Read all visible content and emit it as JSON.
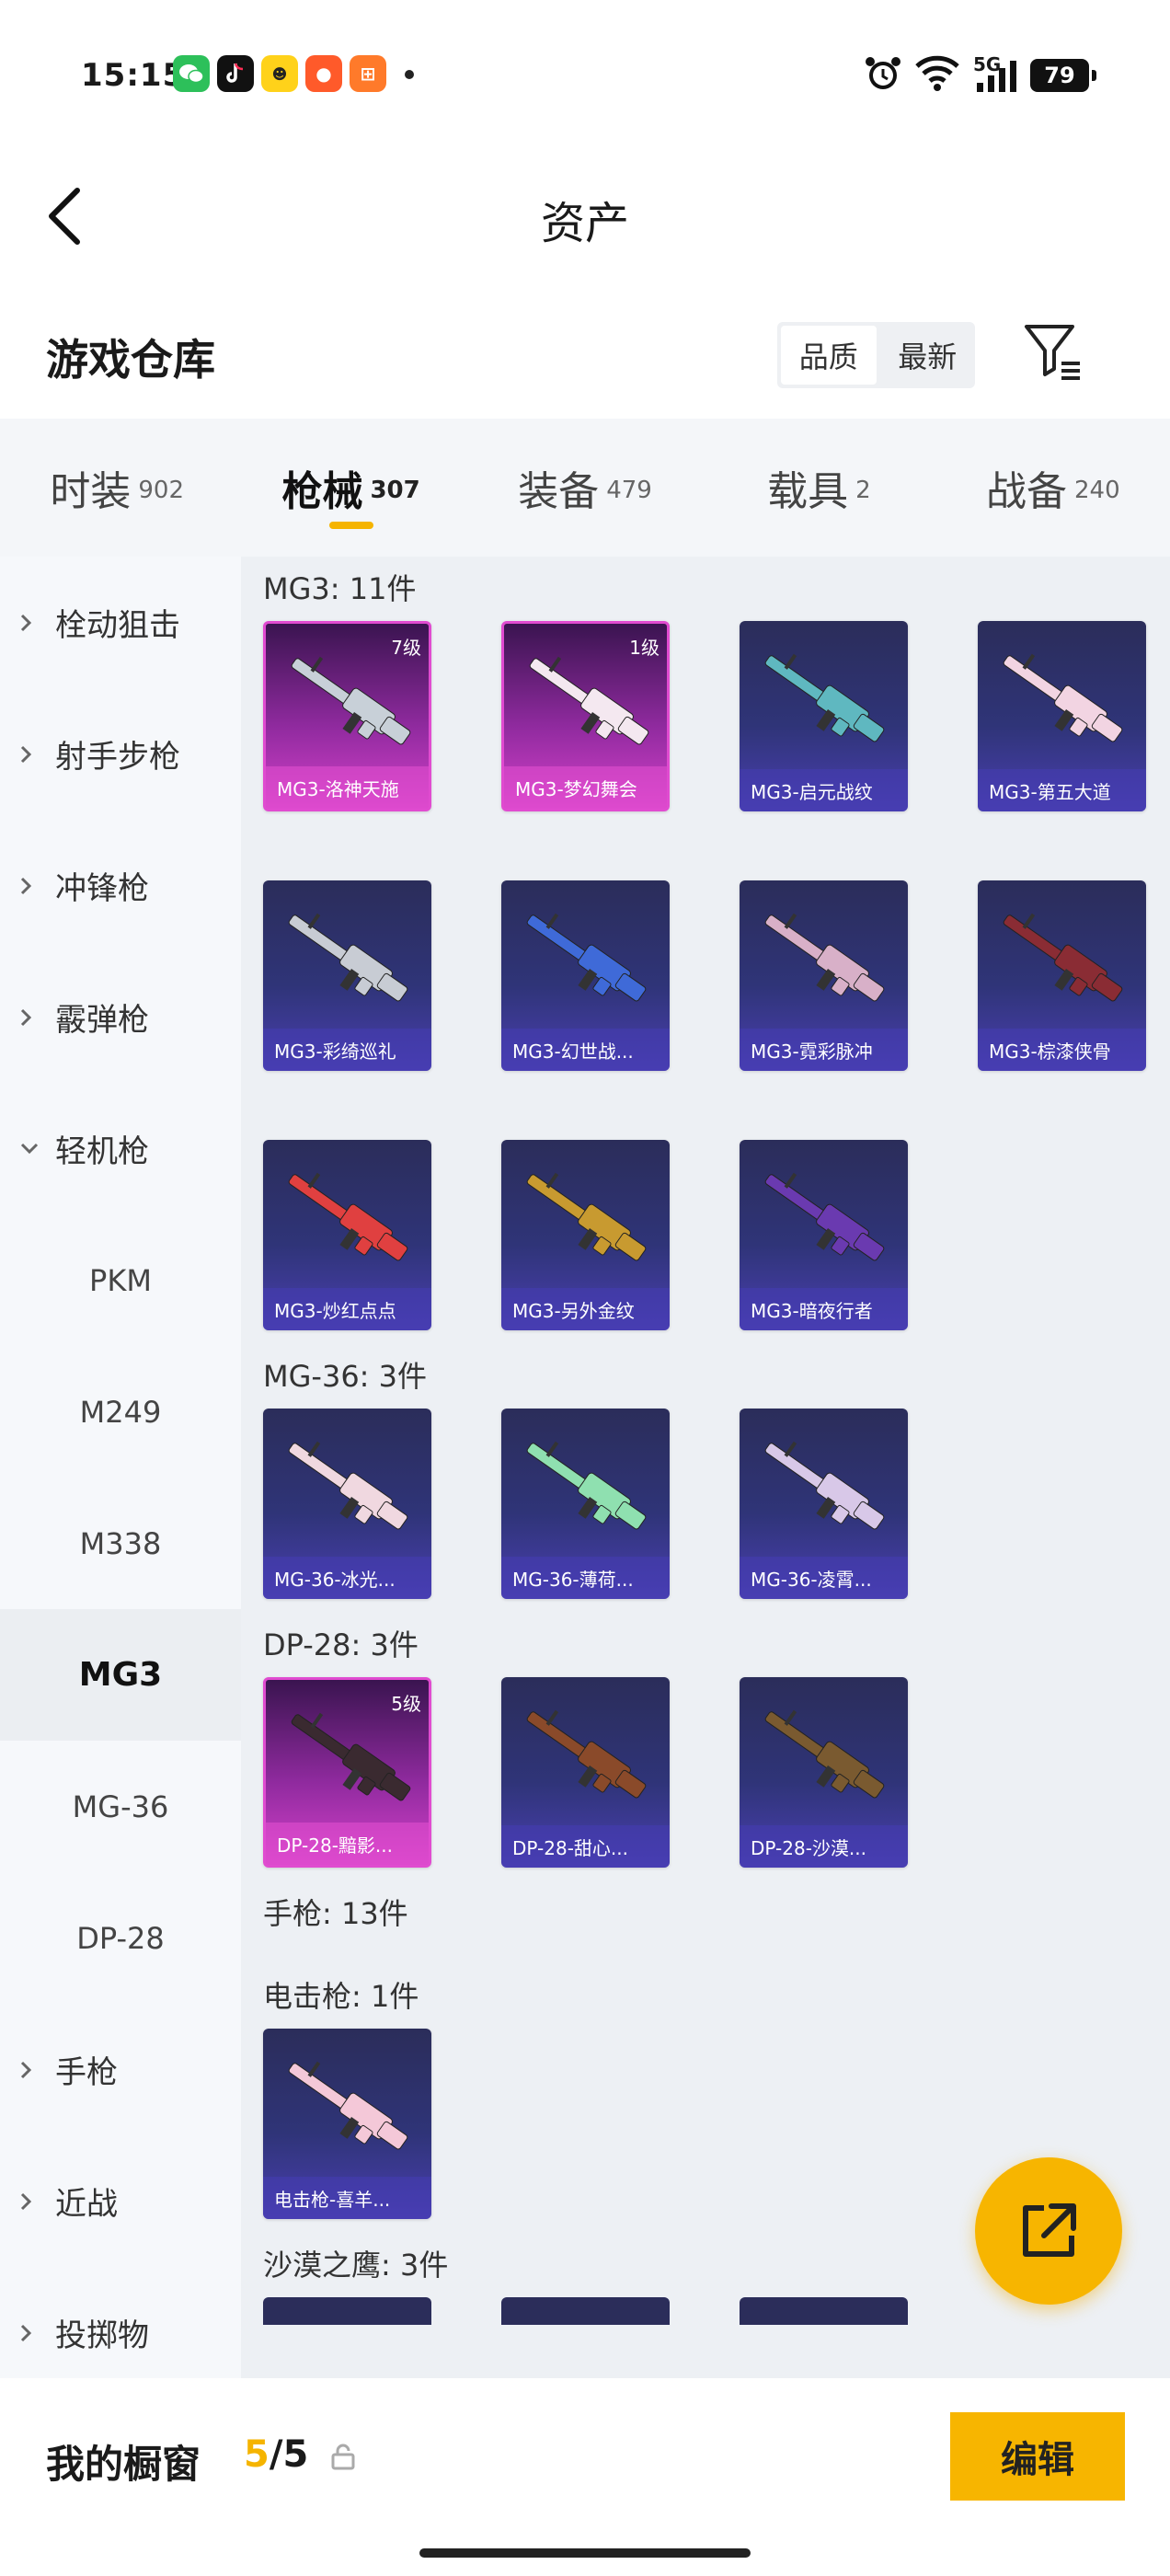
{
  "status_bar": {
    "time": "15:15",
    "network": "5G",
    "battery": "79",
    "notif_icons": [
      "wechat-icon",
      "tiktok-icon",
      "game-app-icon",
      "tomato-app-icon",
      "orange-app-icon"
    ]
  },
  "header": {
    "title": "资产"
  },
  "warehouse": {
    "title": "游戏仓库",
    "sort_options": [
      "品质",
      "最新"
    ],
    "selected_sort": "品质"
  },
  "tabs": [
    {
      "label": "时装",
      "count": "902"
    },
    {
      "label": "枪械",
      "count": "307",
      "active": true
    },
    {
      "label": "装备",
      "count": "479"
    },
    {
      "label": "载具",
      "count": "2"
    },
    {
      "label": "战备",
      "count": "240"
    }
  ],
  "sidebar": [
    {
      "label": "栓动狙击",
      "type": "group",
      "expanded": false
    },
    {
      "label": "射手步枪",
      "type": "group",
      "expanded": false
    },
    {
      "label": "冲锋枪",
      "type": "group",
      "expanded": false
    },
    {
      "label": "霰弹枪",
      "type": "group",
      "expanded": false
    },
    {
      "label": "轻机枪",
      "type": "group",
      "expanded": true
    },
    {
      "label": "PKM",
      "type": "sub"
    },
    {
      "label": "M249",
      "type": "sub"
    },
    {
      "label": "M338",
      "type": "sub"
    },
    {
      "label": "MG3",
      "type": "sub",
      "selected": true
    },
    {
      "label": "MG-36",
      "type": "sub"
    },
    {
      "label": "DP-28",
      "type": "sub"
    },
    {
      "label": "手枪",
      "type": "group",
      "expanded": false
    },
    {
      "label": "近战",
      "type": "group",
      "expanded": false
    },
    {
      "label": "投掷物",
      "type": "group",
      "expanded": false
    }
  ],
  "sections": [
    {
      "title": "MG3: 11件",
      "items": [
        {
          "name": "MG3-洛神天施",
          "level": "7级",
          "rarity": "pink",
          "color": "#c8d0d8"
        },
        {
          "name": "MG3-梦幻舞会",
          "level": "1级",
          "rarity": "pink",
          "color": "#f4e8f0"
        },
        {
          "name": "MG3-启元战纹",
          "rarity": "blue",
          "color": "#5fb8c0"
        },
        {
          "name": "MG3-第五大道",
          "rarity": "blue",
          "color": "#f2d4e2"
        },
        {
          "name": "MG3-彩绮巡礼",
          "rarity": "blue",
          "color": "#c8ccd4"
        },
        {
          "name": "MG3-幻世战...",
          "rarity": "blue",
          "color": "#3f6ad8"
        },
        {
          "name": "MG3-霓彩脉冲",
          "rarity": "blue",
          "color": "#d8b0c8"
        },
        {
          "name": "MG3-棕漆侠骨",
          "rarity": "blue",
          "color": "#8a2c34"
        },
        {
          "name": "MG3-炒红点点",
          "rarity": "blue",
          "color": "#e04040"
        },
        {
          "name": "MG3-另外金纹",
          "rarity": "blue",
          "color": "#c89a30"
        },
        {
          "name": "MG3-暗夜行者",
          "rarity": "blue",
          "color": "#6a3ab0"
        }
      ]
    },
    {
      "title": "MG-36: 3件",
      "items": [
        {
          "name": "MG-36-冰光...",
          "rarity": "blue",
          "color": "#f0d8e0"
        },
        {
          "name": "MG-36-薄荷...",
          "rarity": "blue",
          "color": "#8fe0b0"
        },
        {
          "name": "MG-36-凌霄...",
          "rarity": "blue",
          "color": "#d8c8e8"
        }
      ]
    },
    {
      "title": "DP-28: 3件",
      "items": [
        {
          "name": "DP-28-黯影...",
          "level": "5级",
          "rarity": "pink",
          "color": "#3a2a30"
        },
        {
          "name": "DP-28-甜心...",
          "rarity": "blue",
          "color": "#8a4a2a"
        },
        {
          "name": "DP-28-沙漠...",
          "rarity": "blue",
          "color": "#7a5a30"
        }
      ]
    },
    {
      "title": "手枪: 13件",
      "items": []
    },
    {
      "title": "电击枪: 1件",
      "items": [
        {
          "name": "电击枪-喜羊...",
          "rarity": "blue",
          "color": "#f4c8d8"
        }
      ]
    },
    {
      "title": "沙漠之鹰: 3件",
      "items": []
    }
  ],
  "bottom_bar": {
    "label": "我的橱窗",
    "count_current": "5",
    "count_total": "/5",
    "edit_label": "编辑"
  },
  "colors": {
    "accent": "#f7b500",
    "pink_card": "#d341c9",
    "blue_card": "#2f3478"
  }
}
